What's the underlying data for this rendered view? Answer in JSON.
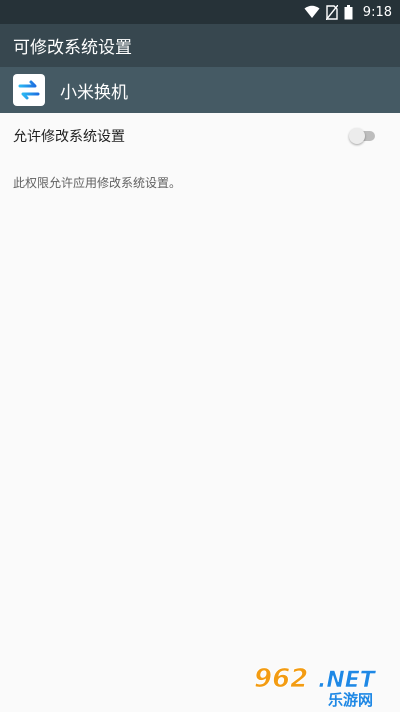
{
  "status_bar": {
    "time": "9:18",
    "icons": [
      "wifi-icon",
      "no-sim-icon",
      "battery-icon"
    ]
  },
  "app_bar": {
    "title": "可修改系统设置"
  },
  "app_header": {
    "app_name": "小米换机",
    "icon": "swap-arrows-icon"
  },
  "setting": {
    "label": "允许修改系统设置",
    "toggle_on": false,
    "description": "此权限允许应用修改系统设置。"
  },
  "watermark": {
    "brand": "962.NET",
    "subtitle": "乐游网"
  },
  "colors": {
    "status_bar": "#263238",
    "app_bar": "#37474f",
    "app_header": "#455a64",
    "background": "#fafafa",
    "watermark_orange": "#f39c12",
    "watermark_blue": "#1e88e5"
  }
}
